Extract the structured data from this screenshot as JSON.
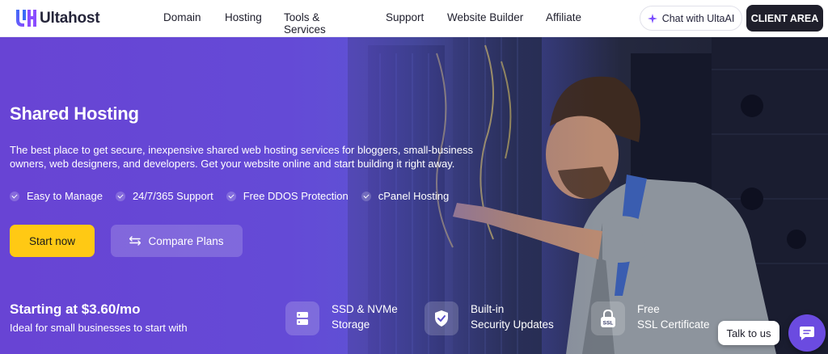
{
  "brand": {
    "name": "Ultahost"
  },
  "nav": {
    "items": [
      "Domain",
      "Hosting",
      "Tools & Services",
      "Support",
      "Website Builder",
      "Affiliate"
    ],
    "chat_label": "Chat with UltaAI",
    "client_label": "CLIENT AREA"
  },
  "hero": {
    "title": "Shared Hosting",
    "description": "The best place to get secure, inexpensive shared web hosting services for bloggers, small-business owners, web designers, and developers. Get your website online and start building it right away.",
    "features": [
      "Easy to Manage",
      "24/7/365 Support",
      "Free DDOS Protection",
      "cPanel Hosting"
    ],
    "start_label": "Start now",
    "compare_label": "Compare Plans",
    "price_text": "Starting at $3.60/mo",
    "price_sub": "Ideal for small businesses to start with"
  },
  "badges": [
    {
      "line1": "SSD & NVMe",
      "line2": "Storage",
      "icon": "storage-icon"
    },
    {
      "line1": "Built-in",
      "line2": "Security Updates",
      "icon": "shield-check-icon"
    },
    {
      "line1": "Free",
      "line2": "SSL Certificate",
      "icon": "ssl-lock-icon",
      "icon_text": "SSL"
    }
  ],
  "widget": {
    "talk_label": "Talk to us"
  },
  "colors": {
    "accent": "#6a3fd0",
    "cta": "#ffc914",
    "dark": "#1f1f2b",
    "logo_blue": "#3b6cf6",
    "logo_purple": "#8a4dff"
  }
}
